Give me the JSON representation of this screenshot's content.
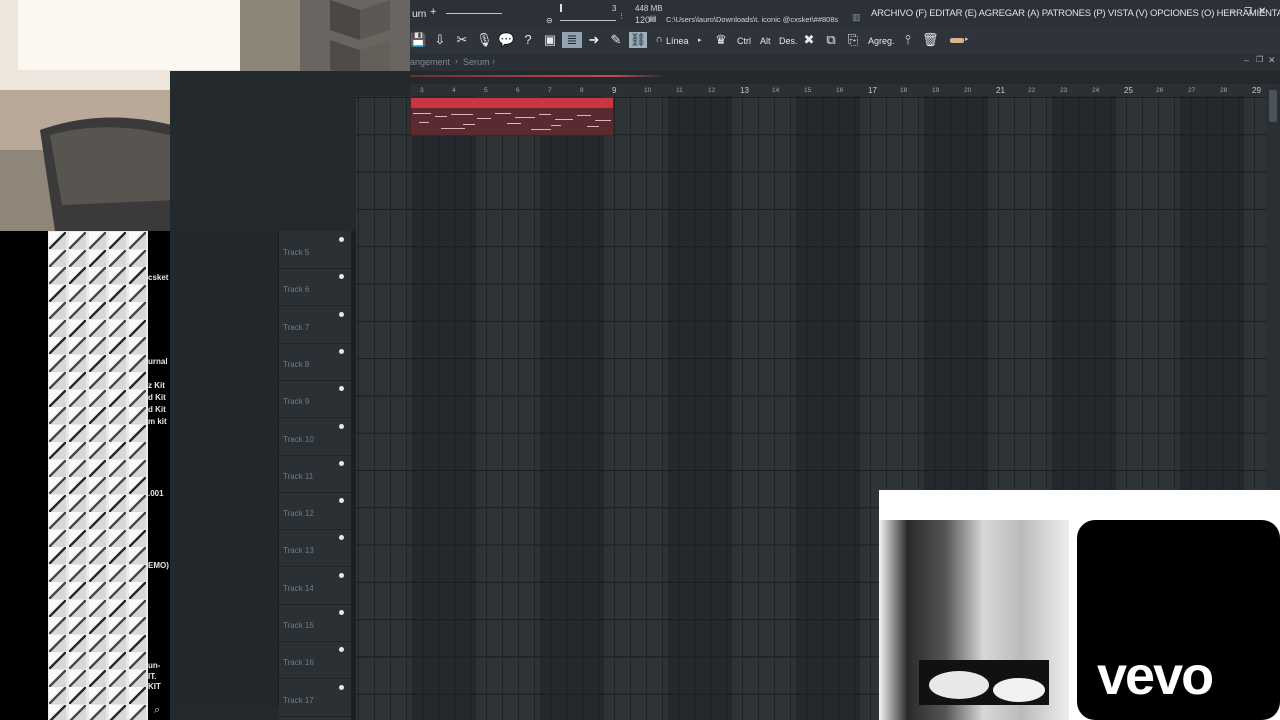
{
  "window": {
    "title_fragment": "um",
    "memory": "448 MB",
    "tempo": "120",
    "cpu_marker": "3",
    "file_path": "C:\\Users\\lauro\\Downloads\\t. iconic @cxsket\\##808s",
    "menu": "ARCHIVO (F) EDITAR (E) AGREGAR (A) PATRONES (P) VISTA (V) OPCIONES (O) HERRAMIENTAS (T) AYUDA"
  },
  "toolbar": {
    "line_label": "Línea",
    "ctrl_label": "Ctrl",
    "alt_label": "Alt",
    "des_label": "Des.",
    "agreg_label": "Agreg."
  },
  "breadcrumb": {
    "first": "angement",
    "second": "Serum"
  },
  "ruler": {
    "bars": [
      "3",
      "4",
      "5",
      "6",
      "7",
      "8",
      "9",
      "10",
      "11",
      "12",
      "13",
      "14",
      "15",
      "16",
      "17",
      "18",
      "19",
      "20",
      "21",
      "22",
      "23",
      "24",
      "25",
      "26",
      "27",
      "28",
      "29"
    ],
    "major_bars": [
      "9",
      "13",
      "17",
      "21",
      "25",
      "29"
    ]
  },
  "browser": {
    "labels": [
      "csket",
      "urnal",
      "z Kit",
      "d Kit",
      "d Kit",
      "m kit",
      ".001",
      "EMO)",
      "un-",
      "IT.",
      "KIT"
    ]
  },
  "tracks": [
    "Track 5",
    "Track 6",
    "Track 7",
    "Track 8",
    "Track 9",
    "Track 10",
    "Track 11",
    "Track 12",
    "Track 13",
    "Track 14",
    "Track 15",
    "Track 16",
    "Track 17"
  ],
  "overlay": {
    "brand": "vevo"
  },
  "colors": {
    "clip_header": "#c7373f",
    "clip_body": "#5a2a30",
    "app_bg": "#24292d",
    "toolbar_bg": "#2e3439"
  }
}
